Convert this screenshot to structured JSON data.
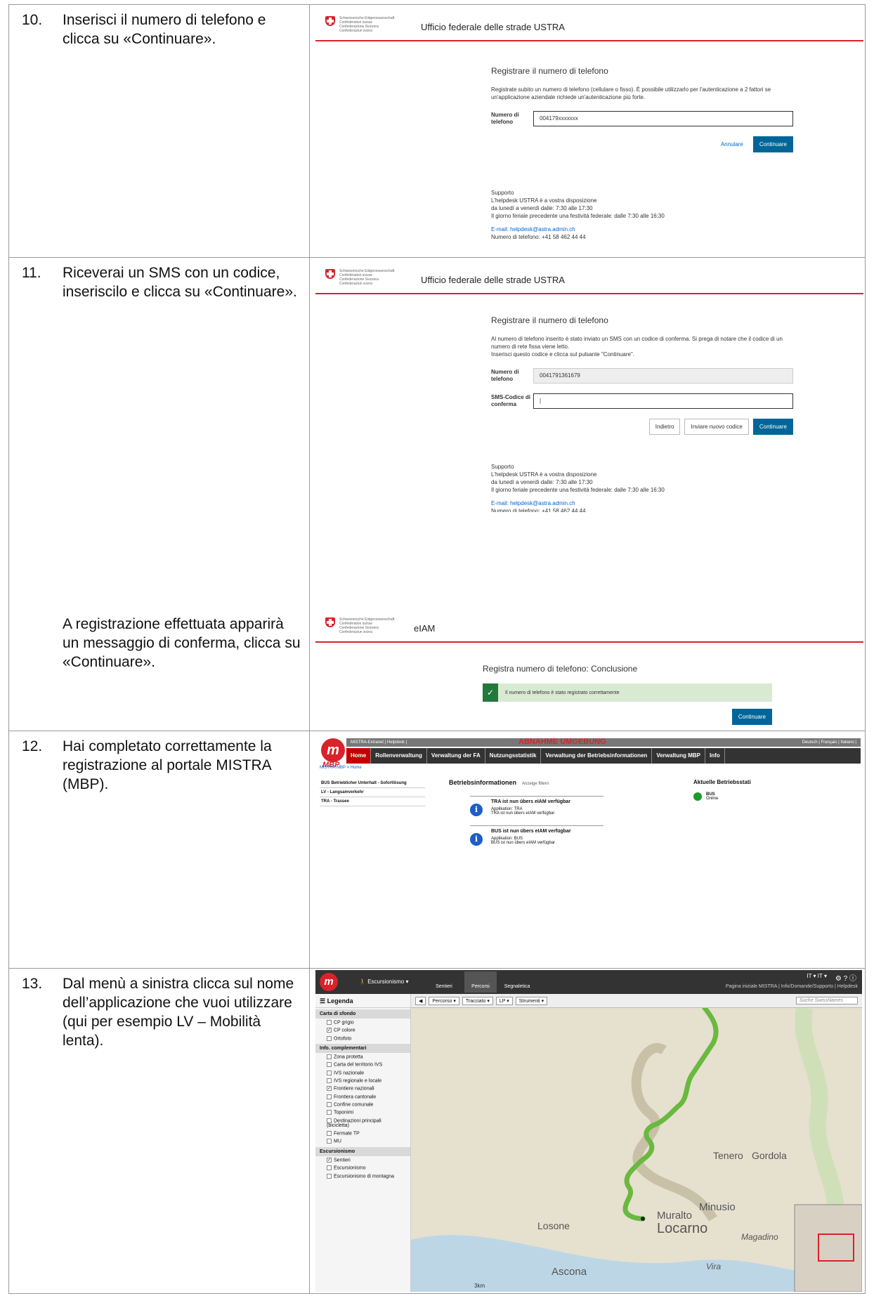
{
  "steps": [
    {
      "num": "10.",
      "text": "Inserisci il numero di telefono e clicca su «Continuare»."
    },
    {
      "num": "11.",
      "text": "Riceverai un SMS con un codice, inseriscilo e clicca su «Continuare»."
    },
    {
      "num": "",
      "text": "A registrazione effettuata apparirà un messaggio di conferma, clicca su «Continuare»."
    },
    {
      "num": "12.",
      "text": "Hai completato correttamente la registrazione al portale MISTRA (MBP)."
    },
    {
      "num": "13.",
      "text": "Dal menù a sinistra clicca sul nome dell’applicazione che vuoi utilizzare (qui per esempio LV – Mobilità lenta)."
    }
  ],
  "confed": [
    "Schweizerische Eidgenossenschaft",
    "Confédération suisse",
    "Confederazione Svizzera",
    "Confederaziun svizra"
  ],
  "shot1": {
    "header": "Ufficio federale delle strade USTRA",
    "title": "Registrare il numero di telefono",
    "desc": "Registrate subito un numero di telefono (cellulare o fisso). È possibile utilizzarlo per l'autenticazione a 2 fattori se un'applicazione aziendale richiede un'autenticazione più forte.",
    "field_label": "Numero di telefono",
    "field_value": "004179xxxxxxx",
    "cancel": "Annulare",
    "continue": "Continuare"
  },
  "shot2": {
    "header": "Ufficio federale delle strade USTRA",
    "title": "Registrare il numero di telefono",
    "desc1": "Al numero di telefono inserito è stato inviato un SMS con un codice di conferma. Si prega di notare che il codice di un numero di rete fissa viene letto.",
    "desc2": "Inserisci questo codice e clicca sul pulsante \"Continuare\".",
    "phone_label": "Numero di telefono",
    "phone_value": "0041791361679",
    "sms_label": "SMS-Codice di conferma",
    "back": "Indietro",
    "resend": "Inviare nuovo codice",
    "continue": "Continuare"
  },
  "support": {
    "title": "Supporto",
    "line1": "L'helpdesk USTRA è a vostra disposizione",
    "line2": "da lunedì a venerdì dalle: 7:30 alle 17:30",
    "line3": "Il giorno feriale precedente una festività federale: dalle 7:30 alle 16:30",
    "email": "E-mail: helpdesk@astra.admin.ch",
    "phone": "Numero di telefono: +41 58 462 44 44"
  },
  "shot3": {
    "header": "eIAM",
    "title": "Registra numero di telefono: Conclusione",
    "message": "Il numero di telefono è stato registrato correttamente",
    "continue": "Continuare"
  },
  "mbp": {
    "logo_sub": "MBP",
    "top_links": "MISTRA-Extranet | Helpdesk |",
    "environment": "ABNAHME UMGEBUNG",
    "languages": "Deutsch | Français | Italiano |",
    "nav": [
      "Home",
      "Rollenverwaltung",
      "Verwaltung der FA",
      "Nutzungsstatistik",
      "Verwaltung der Betriebsinformationen",
      "Verwaltung MBP",
      "Info"
    ],
    "crumb": "MISTRA MBP > Home",
    "apps": [
      "BUS Betrieblicher Unterhalt - Sofortlösung",
      "LV - Langsamverkehr",
      "TRA - Trassee"
    ],
    "info_title": "Betriebsinformationen",
    "filter": "Anzeige filtern",
    "items": [
      {
        "title": "TRA ist nun übers eIAM verfügbar",
        "app": "Applikation: TRA",
        "text": "TRA ist nun übers eIAM verfügbar"
      },
      {
        "title": "BUS ist nun übers eIAM verfügbar",
        "app": "Applikation: BUS",
        "text": "BUS ist nun übers eIAM verfügbar"
      }
    ],
    "status_title": "Aktuelle Betriebsstati",
    "status_name": "BUS",
    "status_value": "Online"
  },
  "map": {
    "mode": "Escursionismo",
    "tabs": [
      "Sentieri",
      "Percorsi",
      "Segnaletica"
    ],
    "lang": "IT ▾  IT ▾",
    "links": "Pagina iniziale MISTRA | Info/Domande/Supporto | Helpdesk",
    "legend_title": "Legenda",
    "sections": [
      {
        "title": "Carta di sfondo",
        "items": [
          [
            "CP grigio",
            ""
          ],
          [
            "CP colore",
            "✓"
          ],
          [
            "Ortofoto",
            ""
          ]
        ]
      },
      {
        "title": "Info. complementari",
        "items": [
          [
            "Zona protetta",
            ""
          ],
          [
            "Carta del territorio IVS",
            ""
          ],
          [
            "IVS nazionale",
            ""
          ],
          [
            "IVS regionale e locale",
            ""
          ],
          [
            "Frontiere nazionali",
            "✓"
          ],
          [
            "Frontiera cantonale",
            ""
          ],
          [
            "Confine comunale",
            ""
          ],
          [
            "Toponimi",
            ""
          ],
          [
            "Destinazioni principali (bicicletta)",
            ""
          ],
          [
            "Fermate TP",
            ""
          ],
          [
            "MU",
            ""
          ]
        ]
      },
      {
        "title": "Escursionismo",
        "items": [
          [
            "Sentieri",
            "✓"
          ],
          [
            "Escursionismo",
            ""
          ],
          [
            "Escursionismo di montagna",
            ""
          ]
        ]
      }
    ],
    "toolbar": [
      "Percorso ▾",
      "Tracciato ▾",
      "LP ▾",
      "Strumenti ▾"
    ],
    "search_placeholder": "Suche SwissNames",
    "place_labels": [
      "Locarno",
      "Muralto",
      "Minusio",
      "Ascona",
      "Losone",
      "Tenero",
      "Gordola",
      "Vira",
      "Magadino"
    ],
    "scale": "3km",
    "route_color": "#6ab93f"
  }
}
